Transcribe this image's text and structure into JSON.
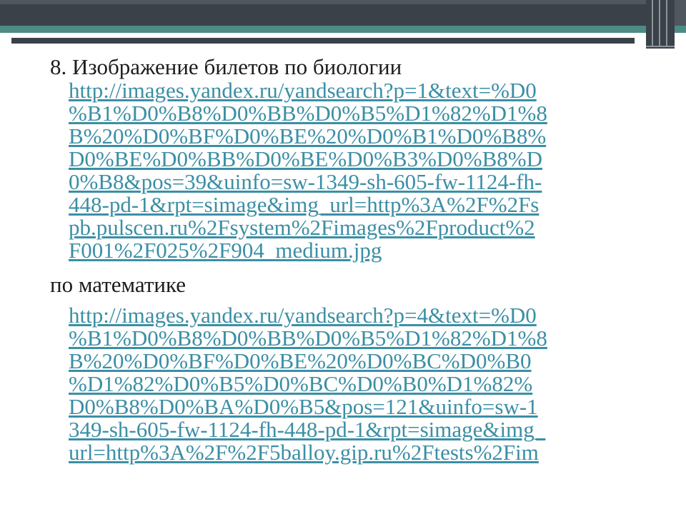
{
  "slide": {
    "heading_biology": "8. Изображение билетов  по биологии",
    "link_biology": [
      " http://images.yandex.ru/yandsearch?p=1&text=%D0",
      "%B1%D0%B8%D0%BB%D0%B5%D1%82%D1%8",
      "B%20%D0%BF%D0%BE%20%D0%B1%D0%B8%",
      "D0%BE%D0%BB%D0%BE%D0%B3%D0%B8%D",
      "0%B8&pos=39&uinfo=sw-1349-sh-605-fw-1124-fh-",
      "448-pd-1&rpt=simage&img_url=http%3A%2F%2Fs",
      "pb.pulscen.ru%2Fsystem%2Fimages%2Fproduct%2",
      "F001%2F025%2F904_medium.jpg"
    ],
    "heading_math": "по математике",
    "link_math": [
      " http://images.yandex.ru/yandsearch?p=4&text=%D0",
      "%B1%D0%B8%D0%BB%D0%B5%D1%82%D1%8",
      "B%20%D0%BF%D0%BE%20%D0%BC%D0%B0",
      "%D1%82%D0%B5%D0%BC%D0%B0%D1%82%",
      "D0%B8%D0%BA%D0%B5&pos=121&uinfo=sw-1",
      "349-sh-605-fw-1124-fh-448-pd-1&rpt=simage&img_",
      "url=http%3A%2F%2F5balloy.gip.ru%2Ftests%2Fim"
    ]
  },
  "colors": {
    "header_dark": "#3b4149",
    "header_teal": "#4d8b87",
    "link": "#3b8fa5",
    "text": "#1c1c1c"
  }
}
